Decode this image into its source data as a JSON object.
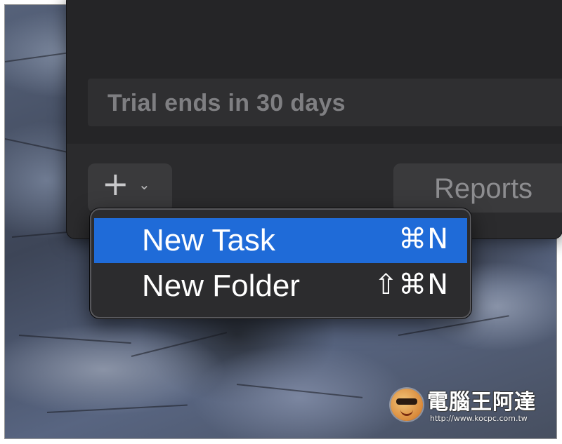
{
  "window": {
    "trial_banner": "Trial ends in 30 days"
  },
  "toolbar": {
    "add_button_icon": "plus-icon",
    "add_button_glyph": "+",
    "chevron_icon": "chevron-down-icon",
    "chevron_glyph": "⌄",
    "reports_tab_label": "Reports"
  },
  "menu": {
    "items": [
      {
        "label": "New Task",
        "shortcut": "⌘N",
        "highlighted": true
      },
      {
        "label": "New Folder",
        "shortcut": "⇧⌘N",
        "highlighted": false
      }
    ]
  },
  "watermark": {
    "title": "電腦王阿達",
    "url": "http://www.kocpc.com.tw"
  },
  "colors": {
    "highlight": "#1f6bd8",
    "window_bg": "#2b2b2d",
    "menu_bg": "#2c2c2e"
  }
}
